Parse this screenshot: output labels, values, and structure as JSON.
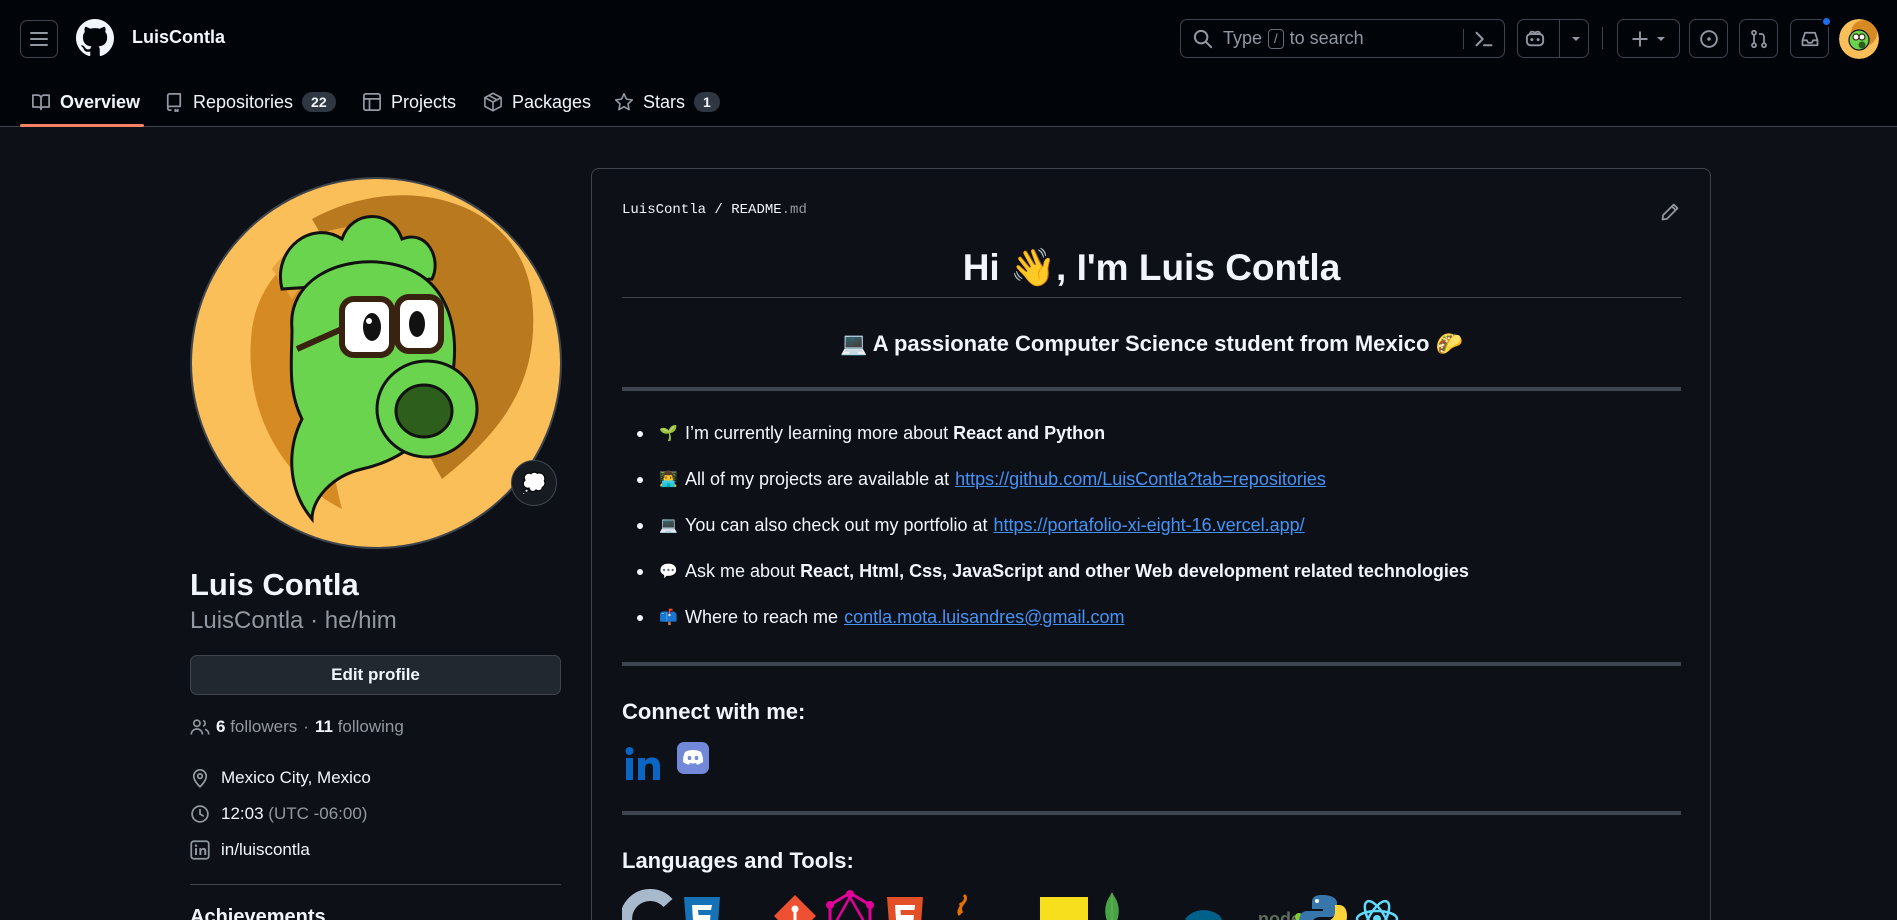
{
  "header": {
    "owner_name": "LuisContla",
    "search": {
      "prefix": "Type",
      "key": "/",
      "suffix": "to search"
    }
  },
  "tabs": [
    {
      "label": "Overview",
      "active": true,
      "icon": "book-icon"
    },
    {
      "label": "Repositories",
      "count": "22",
      "icon": "repo-icon"
    },
    {
      "label": "Projects",
      "icon": "table-icon"
    },
    {
      "label": "Packages",
      "icon": "package-icon"
    },
    {
      "label": "Stars",
      "count": "1",
      "icon": "star-icon"
    }
  ],
  "profile": {
    "name": "Luis Contla",
    "login_line": "LuisContla · he/him",
    "status_emoji": "💭",
    "edit_label": "Edit profile",
    "followers_count": "6",
    "followers_label": "followers",
    "dot": "·",
    "following_count": "11",
    "following_label": "following",
    "location": "Mexico City, Mexico",
    "time": "12:03",
    "timezone": "(UTC -06:00)",
    "linkedin": "in/luiscontla",
    "achievements_heading": "Achievements"
  },
  "readme": {
    "path_owner": "LuisContla",
    "path_sep": "/",
    "path_file": "README",
    "path_ext": ".md",
    "title": "Hi 👋, I'm Luis Contla",
    "subtitle": "💻 A passionate Computer Science student from Mexico 🌮",
    "bullets": [
      {
        "emoji": "🌱",
        "text": "I’m currently learning more about",
        "bold": "React and Python"
      },
      {
        "emoji": "👨‍💻",
        "text": "All of my projects are available at",
        "link": "https://github.com/LuisContla?tab=repositories"
      },
      {
        "emoji": "💻",
        "text": "You can also check out my portfolio at",
        "link": "https://portafolio-xi-eight-16.vercel.app/"
      },
      {
        "emoji": "💬",
        "text": "Ask me about",
        "bold": "React, Html, Css, JavaScript and other Web development related technologies"
      },
      {
        "emoji": "📫",
        "text": "Where to reach me",
        "link": "contla.mota.luisandres@gmail.com"
      }
    ],
    "connect_heading": "Connect with me:",
    "tools_heading": "Languages and Tools:"
  },
  "colors": {
    "accent_tab": "#f78166",
    "link": "#4493f8",
    "avatar_bg": "#fbbf5a",
    "notification": "#1f6feb"
  }
}
